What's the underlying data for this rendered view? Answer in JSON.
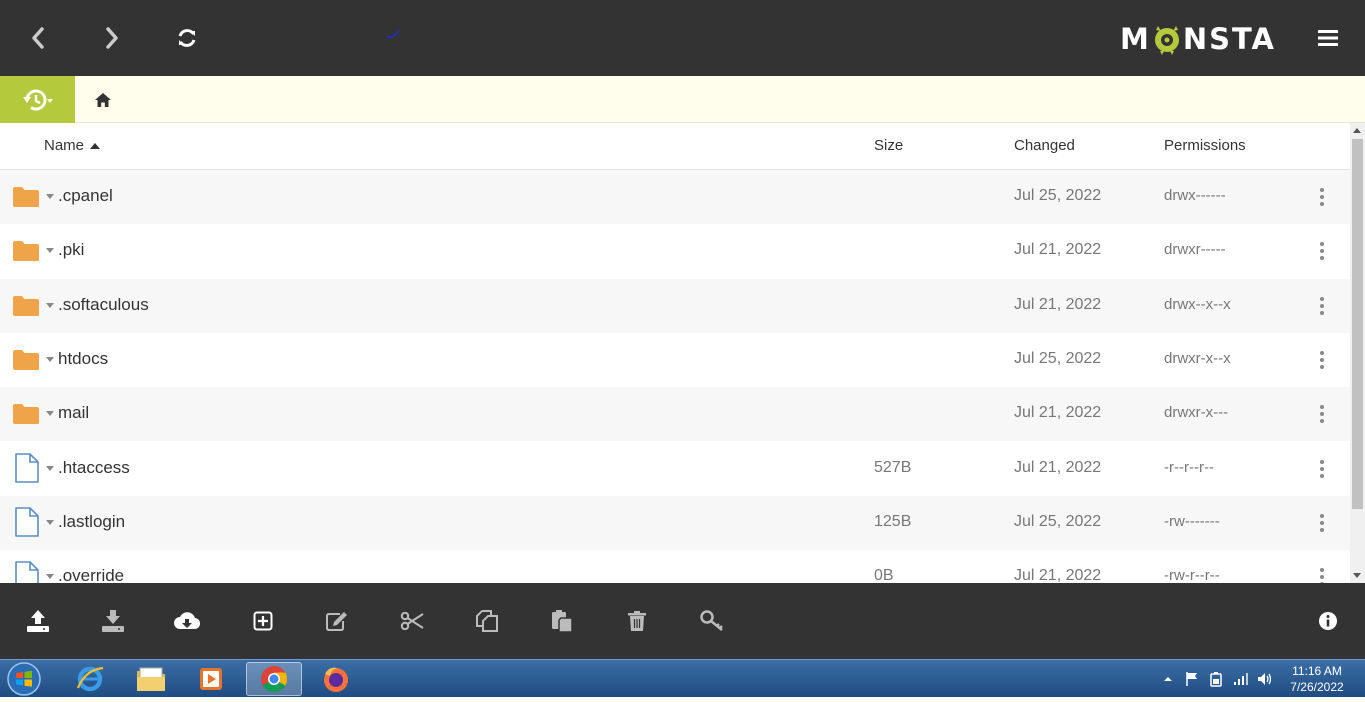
{
  "app": {
    "logo_left": "M",
    "logo_right": "NSTA"
  },
  "table": {
    "headers": {
      "name": "Name",
      "size": "Size",
      "changed": "Changed",
      "permissions": "Permissions"
    },
    "sort_indicator": "ascending",
    "rows": [
      {
        "type": "folder",
        "name": ".cpanel",
        "size": "",
        "changed": "Jul 25, 2022",
        "permissions": "drwx------"
      },
      {
        "type": "folder",
        "name": ".pki",
        "size": "",
        "changed": "Jul 21, 2022",
        "permissions": "drwxr-----"
      },
      {
        "type": "folder",
        "name": ".softaculous",
        "size": "",
        "changed": "Jul 21, 2022",
        "permissions": "drwx--x--x"
      },
      {
        "type": "folder",
        "name": "htdocs",
        "size": "",
        "changed": "Jul 25, 2022",
        "permissions": "drwxr-x--x"
      },
      {
        "type": "folder",
        "name": "mail",
        "size": "",
        "changed": "Jul 21, 2022",
        "permissions": "drwxr-x---"
      },
      {
        "type": "file",
        "name": ".htaccess",
        "size": "527B",
        "changed": "Jul 21, 2022",
        "permissions": "-r--r--r--"
      },
      {
        "type": "file",
        "name": ".lastlogin",
        "size": "125B",
        "changed": "Jul 25, 2022",
        "permissions": "-rw-------"
      },
      {
        "type": "file",
        "name": ".override",
        "size": "0B",
        "changed": "Jul 21, 2022",
        "permissions": "-rw-r--r--"
      }
    ]
  },
  "taskbar": {
    "time": "11:16 AM",
    "date": "7/26/2022"
  },
  "colors": {
    "topbar": "#333333",
    "accent": "#b5c93c",
    "breadcrumb_bg": "#fffdeb",
    "folder": "#f0a44a",
    "file_icon": "#5b8ec4"
  }
}
